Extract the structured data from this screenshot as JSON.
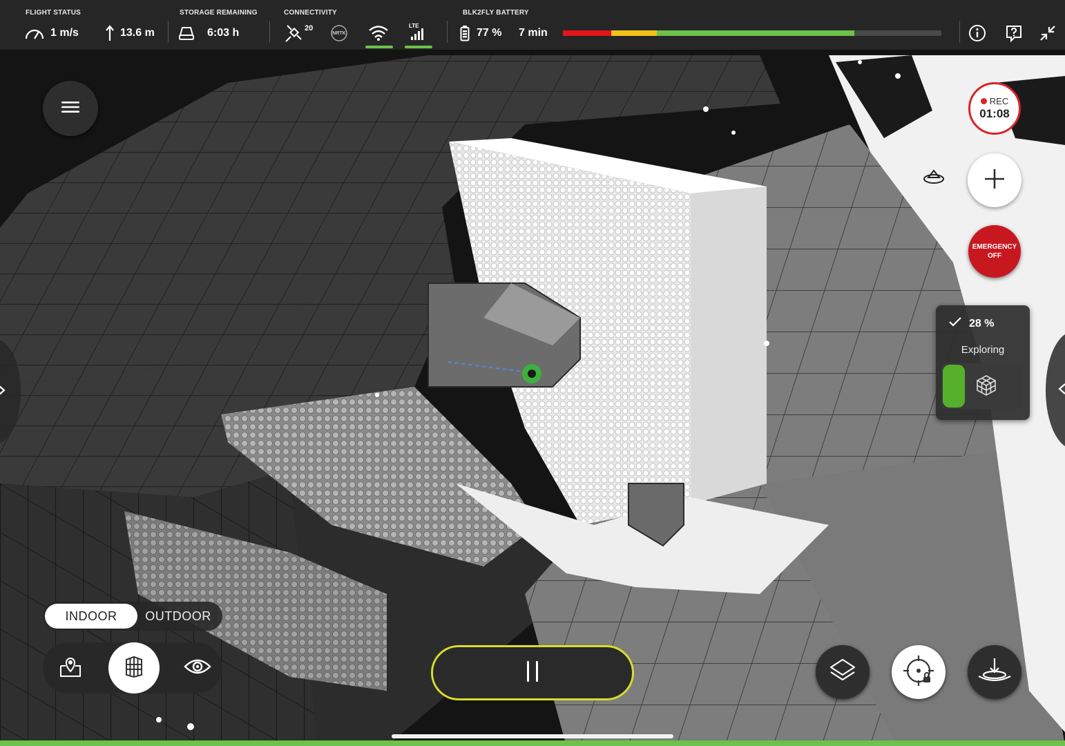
{
  "colors": {
    "accent_green": "#6cc24a",
    "record_red": "#d8232a",
    "emergency_red": "#c8181f",
    "pause_outline": "#d8dd2b",
    "battery_red": "#e3141b",
    "battery_yellow": "#f2c21b",
    "battery_green": "#6cc24a"
  },
  "status_bar": {
    "flight_status": {
      "label": "FLIGHT STATUS",
      "speed": "1 m/s",
      "altitude": "13.6 m",
      "icons": [
        "speedometer-icon",
        "altitude-arrow-icon"
      ]
    },
    "storage": {
      "label": "STORAGE REMAINING",
      "value": "6:03 h",
      "icon": "storage-drive-icon"
    },
    "connectivity": {
      "label": "CONNECTIVITY",
      "satellites": "20",
      "nrtk": "NRTK",
      "lte": "LTE",
      "icons": [
        "satellite-icon",
        "nrtk-icon",
        "wifi-icon",
        "lte-signal-icon"
      ]
    },
    "battery": {
      "label": "BLK2FLY BATTERY",
      "percent": "77 %",
      "time_remaining": "7 min",
      "level_fraction": 0.77,
      "icon": "battery-icon"
    },
    "right_icons": [
      "info-icon",
      "help-icon",
      "collapse-icon"
    ]
  },
  "controls": {
    "menu_icon": "hamburger-menu-icon",
    "recording": {
      "label": "REC",
      "time": "01:08"
    },
    "add_icon": "plus-icon",
    "emergency": {
      "line1": "EMERGENCY",
      "line2": "OFF"
    },
    "exploration": {
      "percent": "28 %",
      "status": "Exploring",
      "icon": "voxel-cube-icon"
    }
  },
  "environment_mode": {
    "options": [
      "INDOOR",
      "OUTDOOR"
    ],
    "selected": "INDOOR"
  },
  "view_modes": [
    "map-pin-icon",
    "building-view-icon",
    "eye-icon"
  ],
  "bottom_actions": [
    "pause-icon",
    "layers-icon",
    "recenter-lock-icon",
    "landing-icon"
  ]
}
